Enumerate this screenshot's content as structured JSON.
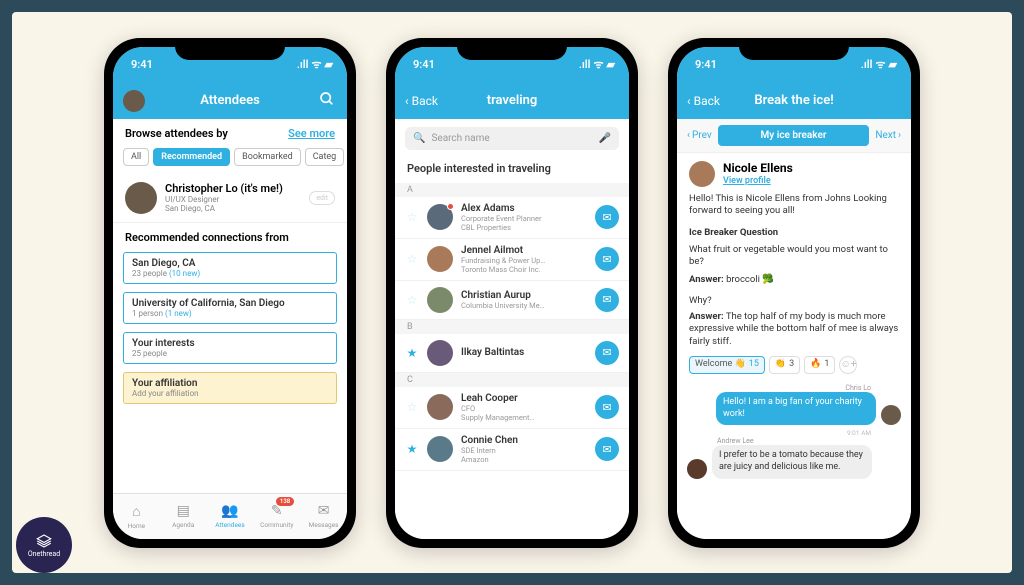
{
  "status": {
    "time": "9:41",
    "signal": "▪▪▪▪",
    "wifi": "◉",
    "battery": "■"
  },
  "phone1": {
    "header_title": "Attendees",
    "browse_label": "Browse attendees by",
    "see_more": "See more",
    "pills": [
      {
        "label": "All",
        "active": false
      },
      {
        "label": "Recommended",
        "active": true
      },
      {
        "label": "Bookmarked",
        "active": false
      },
      {
        "label": "Categ",
        "active": false
      }
    ],
    "me": {
      "name": "Christopher Lo (it's me!)",
      "title": "UI/UX Designer",
      "loc": "San Diego, CA"
    },
    "rec_title": "Recommended connections from",
    "cards": [
      {
        "title": "San Diego, CA",
        "sub": "23 people",
        "new": "(10 new)",
        "hl": false
      },
      {
        "title": "University of California, San Diego",
        "sub": "1 person",
        "new": "(1 new)",
        "hl": false
      },
      {
        "title": "Your interests",
        "sub": "25 people",
        "new": "",
        "hl": false
      },
      {
        "title": "Your affiliation",
        "sub": "Add your affiliation",
        "new": "",
        "hl": true
      }
    ],
    "tabs": [
      {
        "label": "Home",
        "icon": "⌂",
        "badge": ""
      },
      {
        "label": "Agenda",
        "icon": "▤",
        "badge": ""
      },
      {
        "label": "Attendees",
        "icon": "👥",
        "badge": "",
        "active": true
      },
      {
        "label": "Community",
        "icon": "✎",
        "badge": "138"
      },
      {
        "label": "Messages",
        "icon": "✉",
        "badge": ""
      }
    ]
  },
  "phone2": {
    "back": "Back",
    "header_title": "traveling",
    "search_placeholder": "Search name",
    "interest_label": "People interested in traveling",
    "groups": [
      {
        "letter": "A",
        "people": [
          {
            "name": "Alex Adams",
            "title": "Corporate Event Planner",
            "org": "CBL Properties",
            "starred": false,
            "dot": true
          },
          {
            "name": "Jennel Ailmot",
            "title": "Fundraising & Power Up…",
            "org": "Toronto Mass Choir Inc.",
            "starred": false
          },
          {
            "name": "Christian Aurup",
            "title": "Columbia University Me…",
            "org": "",
            "starred": false
          }
        ]
      },
      {
        "letter": "B",
        "people": [
          {
            "name": "Ilkay Baltintas",
            "title": "",
            "org": "",
            "starred": true
          }
        ]
      },
      {
        "letter": "C",
        "people": [
          {
            "name": "Leah Cooper",
            "title": "CFO",
            "org": "Supply Management…",
            "starred": false
          },
          {
            "name": "Connie Chen",
            "title": "SDE Intern",
            "org": "Amazon",
            "starred": true
          }
        ]
      }
    ]
  },
  "phone3": {
    "back": "Back",
    "header_title": "Break the ice!",
    "prev": "Prev",
    "center": "My ice breaker",
    "next": "Next",
    "profile": {
      "name": "Nicole Ellens",
      "link": "View profile"
    },
    "intro": "Hello! This is Nicole Ellens from Johns Looking forward to seeing you all!",
    "q_label": "Ice Breaker Question",
    "q_text": "What fruit or vegetable would you most want to be?",
    "a1_label": "Answer:",
    "a1_text": "broccoli 🥦",
    "why": "Why?",
    "a2_label": "Answer:",
    "a2_text": "The top half of my body is much more expressive while the bottom half of mee is always fairly stiff.",
    "reactions": [
      {
        "label": "Welcome 👋",
        "count": "15",
        "active": true
      },
      {
        "label": "👏",
        "count": "3",
        "active": false
      },
      {
        "label": "🔥",
        "count": "1",
        "active": false
      }
    ],
    "chat": [
      {
        "side": "right",
        "sender": "Chris Lo",
        "text": "Hello! I am a big fan of your charity work!",
        "time": "9:01 AM"
      },
      {
        "side": "left",
        "sender": "Andrew Lee",
        "text": "I prefer to be a tomato because they are juicy and delicious like me.",
        "time": ""
      }
    ]
  },
  "brand": "Onethread"
}
